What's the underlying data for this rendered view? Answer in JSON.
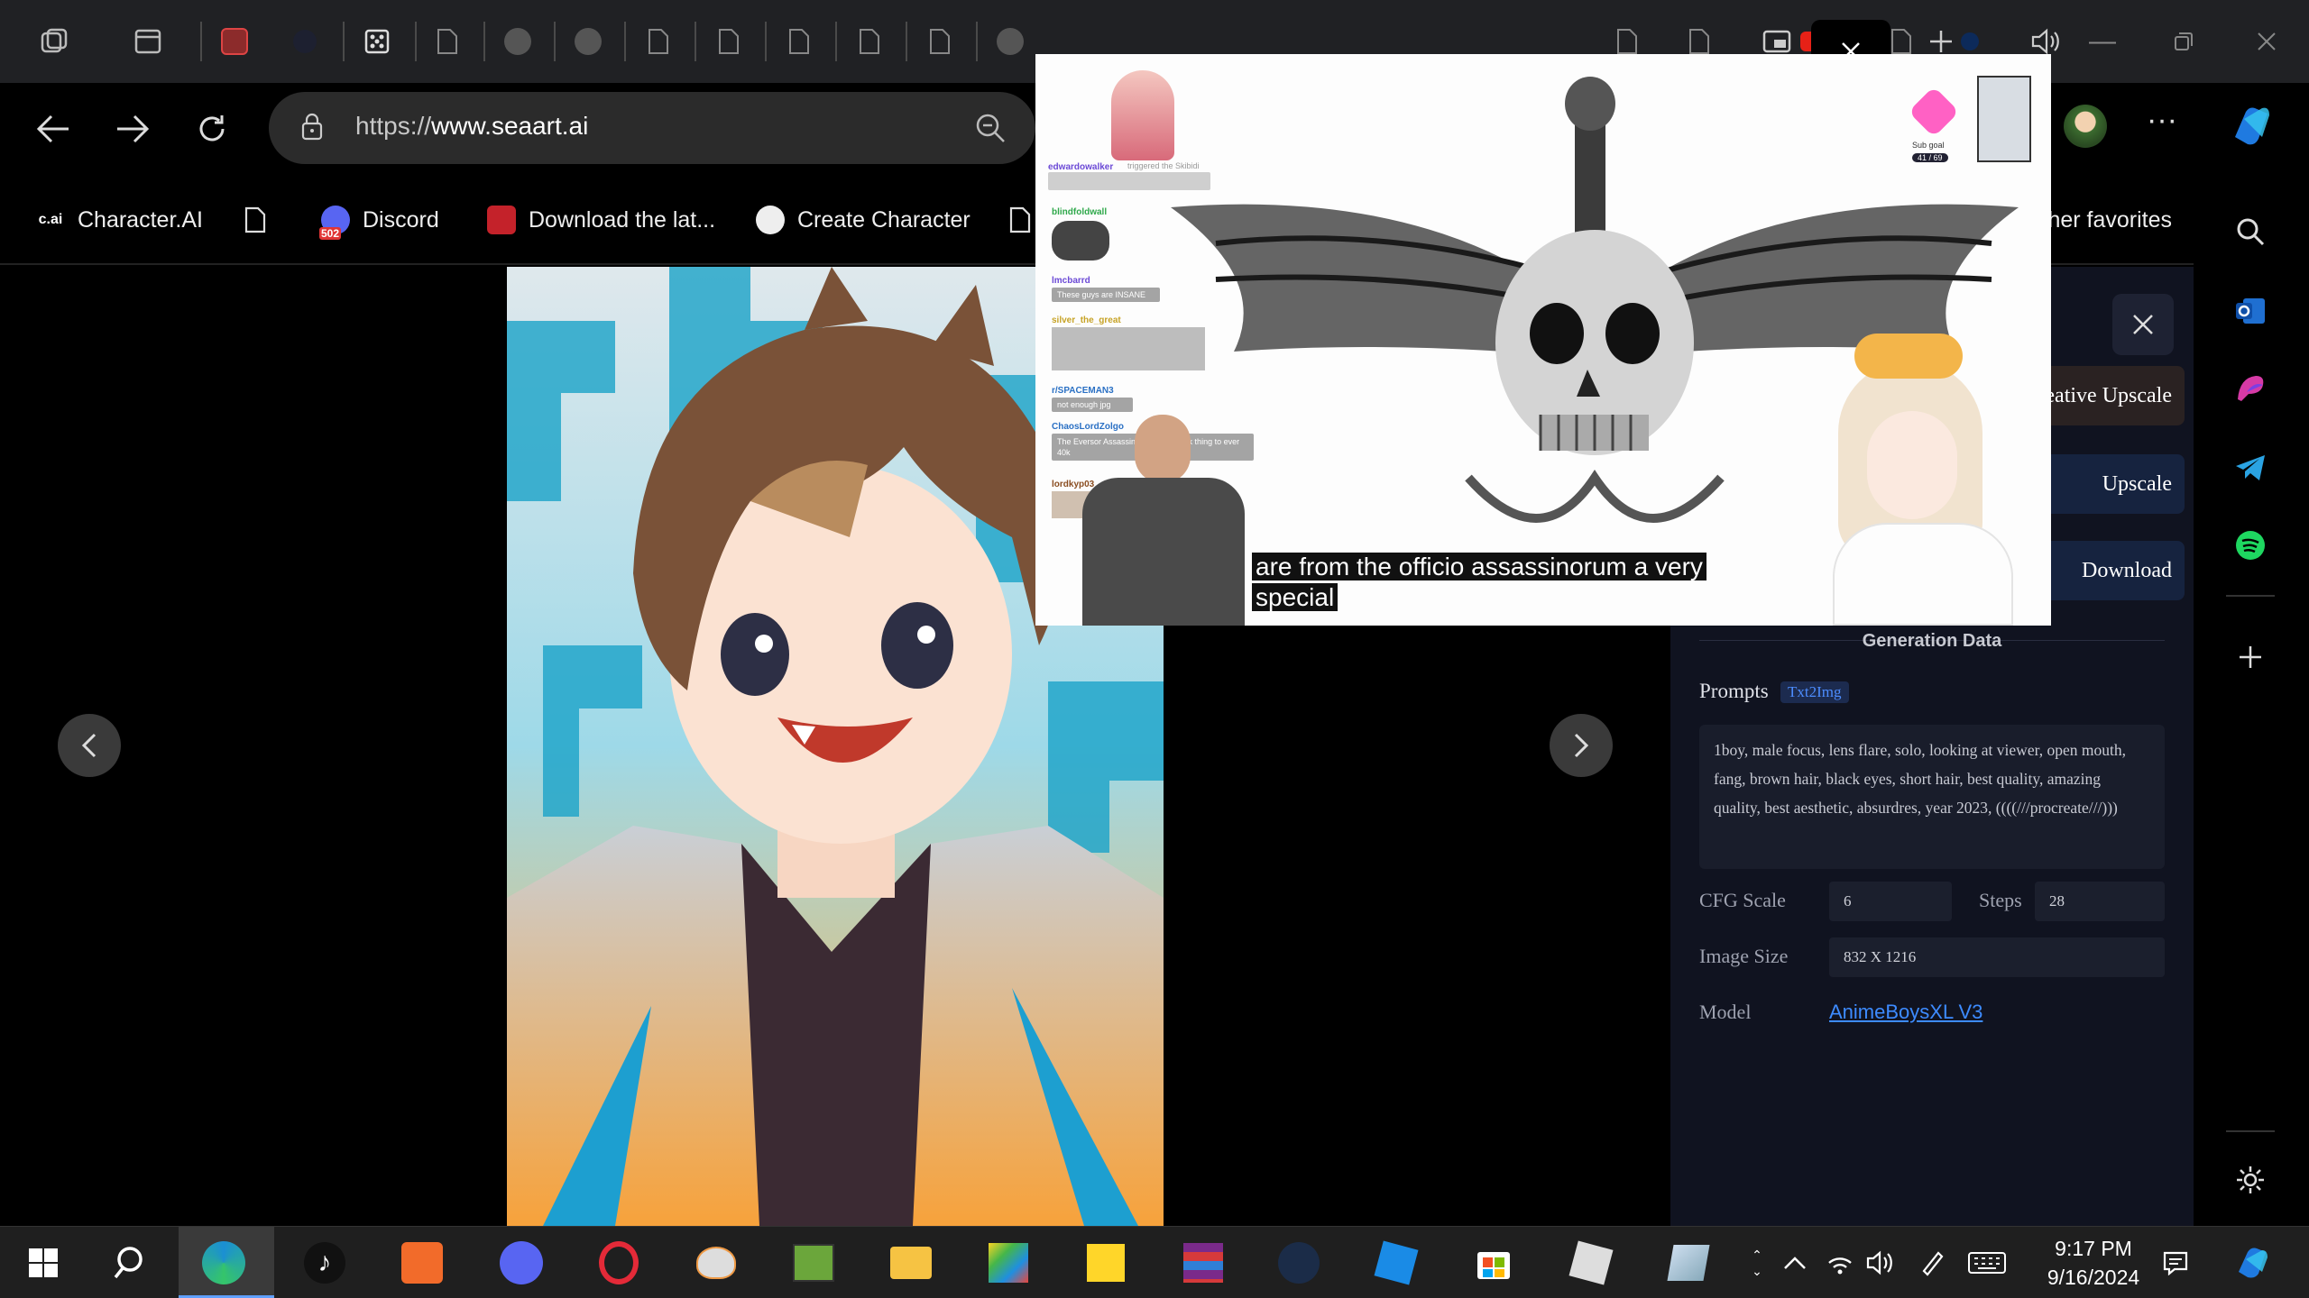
{
  "browser": {
    "url_prefix": "https://",
    "url_domain": "www.seaart.ai",
    "favorites": [
      {
        "label": "Character.AI",
        "icon_text": "c.ai"
      },
      {
        "label": "Discord",
        "icon_text": "502"
      },
      {
        "label": "Download the lat..."
      },
      {
        "label": "Create Character"
      },
      {
        "label": "Other favorites"
      }
    ]
  },
  "panel": {
    "buttons": [
      "Creative Upscale",
      "Upscale",
      "Download"
    ],
    "generation_data_title": "Generation Data",
    "prompts_label": "Prompts",
    "prompt_type": "Txt2Img",
    "prompt_text": "1boy, male focus, lens flare, solo, looking at viewer, open mouth, fang, brown hair, black eyes, short hair, best quality, amazing quality, best aesthetic, absurdres, year 2023, ((((///procreate///)))",
    "cfg_label": "CFG Scale",
    "cfg_value": "6",
    "steps_label": "Steps",
    "steps_value": "28",
    "size_label": "Image Size",
    "size_value": "832 X 1216",
    "model_label": "Model",
    "model_value": "AnimeBoysXL V3"
  },
  "pip": {
    "caption_line1": "are from the officio assassinorum a very",
    "caption_line2": "special",
    "subgoal_label": "Sub goal",
    "subgoal_value": "41 / 69",
    "chat": [
      {
        "name": "edwardowalker",
        "msg": "triggered the Skibidi"
      },
      {
        "name": "blindfoldwall",
        "msg": ""
      },
      {
        "name": "lmcbarrd",
        "msg": "These guys are INSANE"
      },
      {
        "name": "silver_the_great",
        "msg": ""
      },
      {
        "name": "r/SPACEMAN3",
        "msg": "not enough jpg"
      },
      {
        "name": "ChaosLordZolgo",
        "msg": "The Eversor Assassin is the most 40k thing to ever 40k"
      },
      {
        "name": "lordkyp03",
        "msg": ""
      }
    ]
  },
  "taskbar": {
    "time": "9:17 PM",
    "date": "9/16/2024"
  },
  "colors": {
    "accent_blue": "#3d8bff",
    "panel_bg": "#101320",
    "button_dark": "#2a2222",
    "button_blue": "#16233f"
  }
}
